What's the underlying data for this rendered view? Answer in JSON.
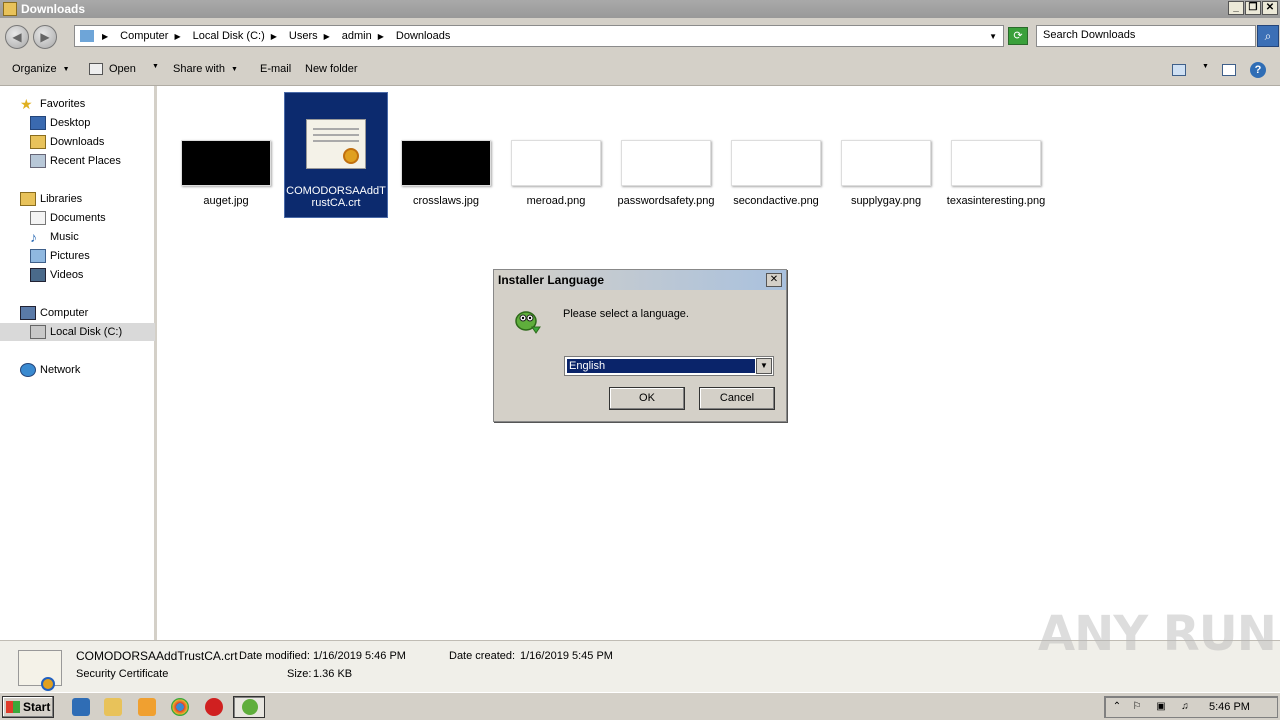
{
  "window": {
    "title": "Downloads"
  },
  "address": {
    "crumbs": [
      "Computer",
      "Local Disk (C:)",
      "Users",
      "admin",
      "Downloads"
    ],
    "search_placeholder": "Search Downloads"
  },
  "toolbar": {
    "organize": "Organize",
    "open": "Open",
    "share_with": "Share with",
    "email": "E-mail",
    "new_folder": "New folder"
  },
  "sidebar": {
    "favorites": "Favorites",
    "desktop": "Desktop",
    "downloads": "Downloads",
    "recent_places": "Recent Places",
    "libraries": "Libraries",
    "documents": "Documents",
    "music": "Music",
    "pictures": "Pictures",
    "videos": "Videos",
    "computer": "Computer",
    "local_disk": "Local Disk (C:)",
    "network": "Network"
  },
  "files": [
    {
      "name": "auget.jpg",
      "thumb": "dark"
    },
    {
      "name": "COMODORSAAddTrustCA.crt",
      "thumb": "cert"
    },
    {
      "name": "crosslaws.jpg",
      "thumb": "dark"
    },
    {
      "name": "meroad.png",
      "thumb": "light"
    },
    {
      "name": "passwordsafety.png",
      "thumb": "light"
    },
    {
      "name": "secondactive.png",
      "thumb": "light"
    },
    {
      "name": "supplygay.png",
      "thumb": "light"
    },
    {
      "name": "texasinteresting.png",
      "thumb": "light"
    }
  ],
  "dialog": {
    "title": "Installer Language",
    "message": "Please select a language.",
    "selected_language": "English",
    "ok": "OK",
    "cancel": "Cancel"
  },
  "details": {
    "file_name": "COMODORSAAddTrustCA.crt",
    "file_type": "Security Certificate",
    "date_modified_label": "Date modified:",
    "date_modified": "1/16/2019 5:46 PM",
    "date_created_label": "Date created:",
    "date_created": "1/16/2019 5:45 PM",
    "size_label": "Size:",
    "size": "1.36 KB"
  },
  "watermark": "ANY RUN",
  "taskbar": {
    "start": "Start",
    "clock": "5:46 PM"
  },
  "colors": {
    "selection": "#0c2a6e",
    "dialog_bg": "#d4d0c8",
    "highlight": "#0a246a"
  }
}
